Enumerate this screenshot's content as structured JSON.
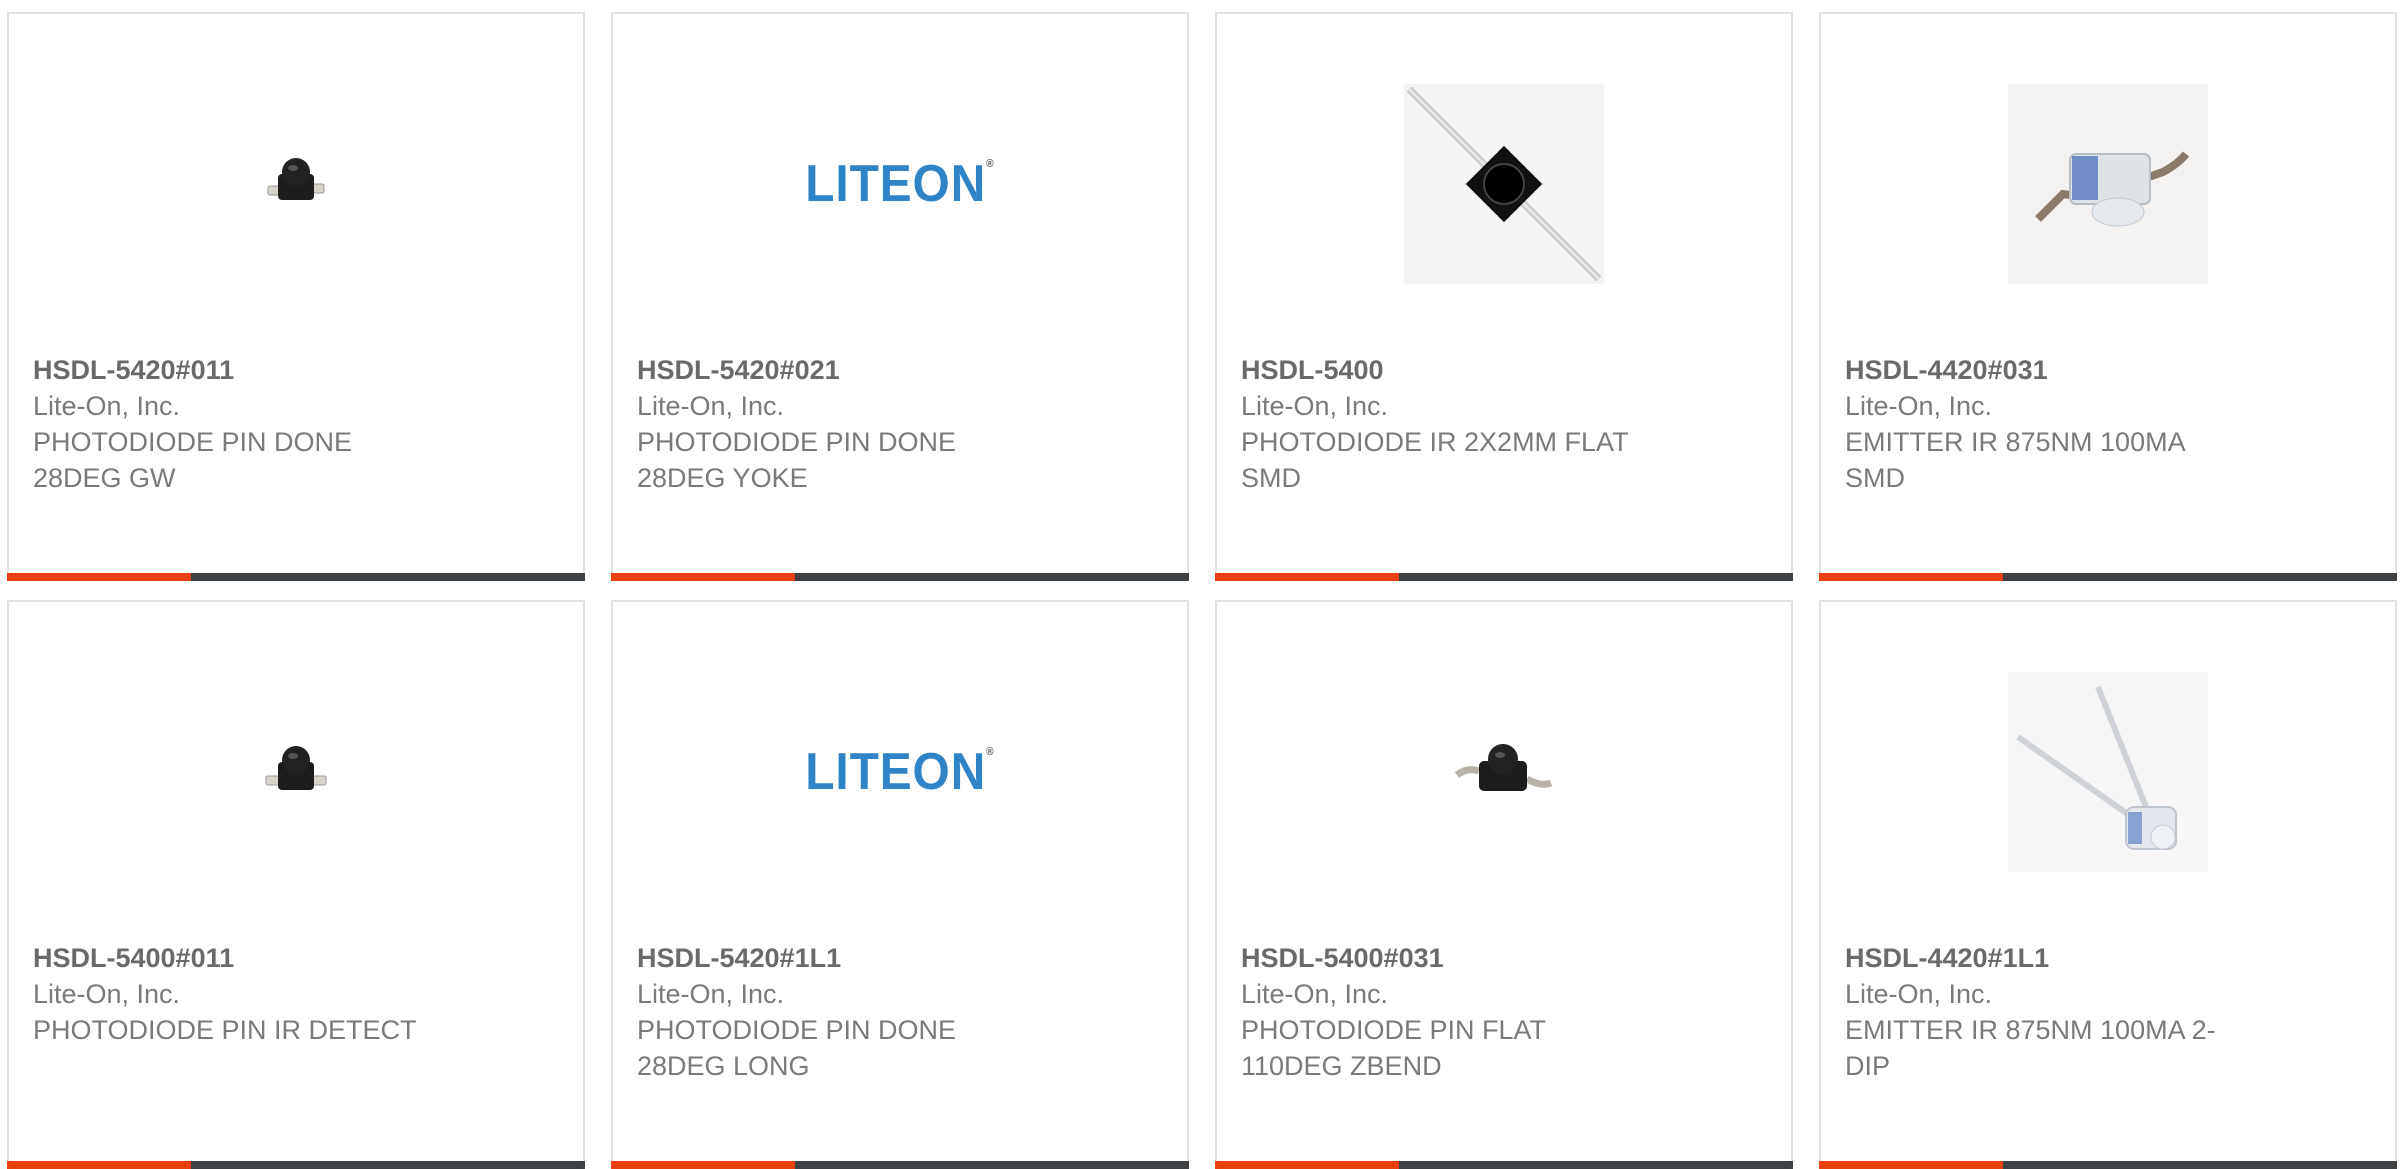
{
  "products": [
    {
      "part": "HSDL-5420#011",
      "maker": "Lite-On, Inc.",
      "desc1": "PHOTODIODE PIN DONE",
      "desc2": "28DEG GW",
      "image": "photodiode-black-small-icon"
    },
    {
      "part": "HSDL-5420#021",
      "maker": "Lite-On, Inc.",
      "desc1": "PHOTODIODE PIN DONE",
      "desc2": "28DEG YOKE",
      "image": "liteon-logo",
      "logo_text": "LITEON",
      "logo_mark": "®"
    },
    {
      "part": "HSDL-5400",
      "maker": "Lite-On, Inc.",
      "desc1": "PHOTODIODE IR 2X2MM FLAT",
      "desc2": "SMD",
      "image": "photodiode-leaded-diagonal-icon"
    },
    {
      "part": "HSDL-4420#031",
      "maker": "Lite-On, Inc.",
      "desc1": "EMITTER IR 875NM 100MA",
      "desc2": "SMD",
      "image": "emitter-smd-clear-icon"
    },
    {
      "part": "HSDL-5400#011",
      "maker": "Lite-On, Inc.",
      "desc1": "PHOTODIODE PIN IR DETECT",
      "desc2": "",
      "image": "photodiode-black-small-icon"
    },
    {
      "part": "HSDL-5420#1L1",
      "maker": "Lite-On, Inc.",
      "desc1": "PHOTODIODE PIN DONE",
      "desc2": "28DEG LONG",
      "image": "liteon-logo",
      "logo_text": "LITEON",
      "logo_mark": "®"
    },
    {
      "part": "HSDL-5400#031",
      "maker": "Lite-On, Inc.",
      "desc1": "PHOTODIODE PIN FLAT",
      "desc2": "110DEG ZBEND",
      "image": "photodiode-zbend-icon"
    },
    {
      "part": "HSDL-4420#1L1",
      "maker": "Lite-On, Inc.",
      "desc1": "EMITTER IR 875NM 100MA 2-",
      "desc2": "DIP",
      "image": "emitter-dip-leads-icon"
    }
  ],
  "colors": {
    "accent": "#e8400f",
    "bar": "#3e4244",
    "text": "#7a7a7a",
    "logo": "#2f84c7"
  }
}
